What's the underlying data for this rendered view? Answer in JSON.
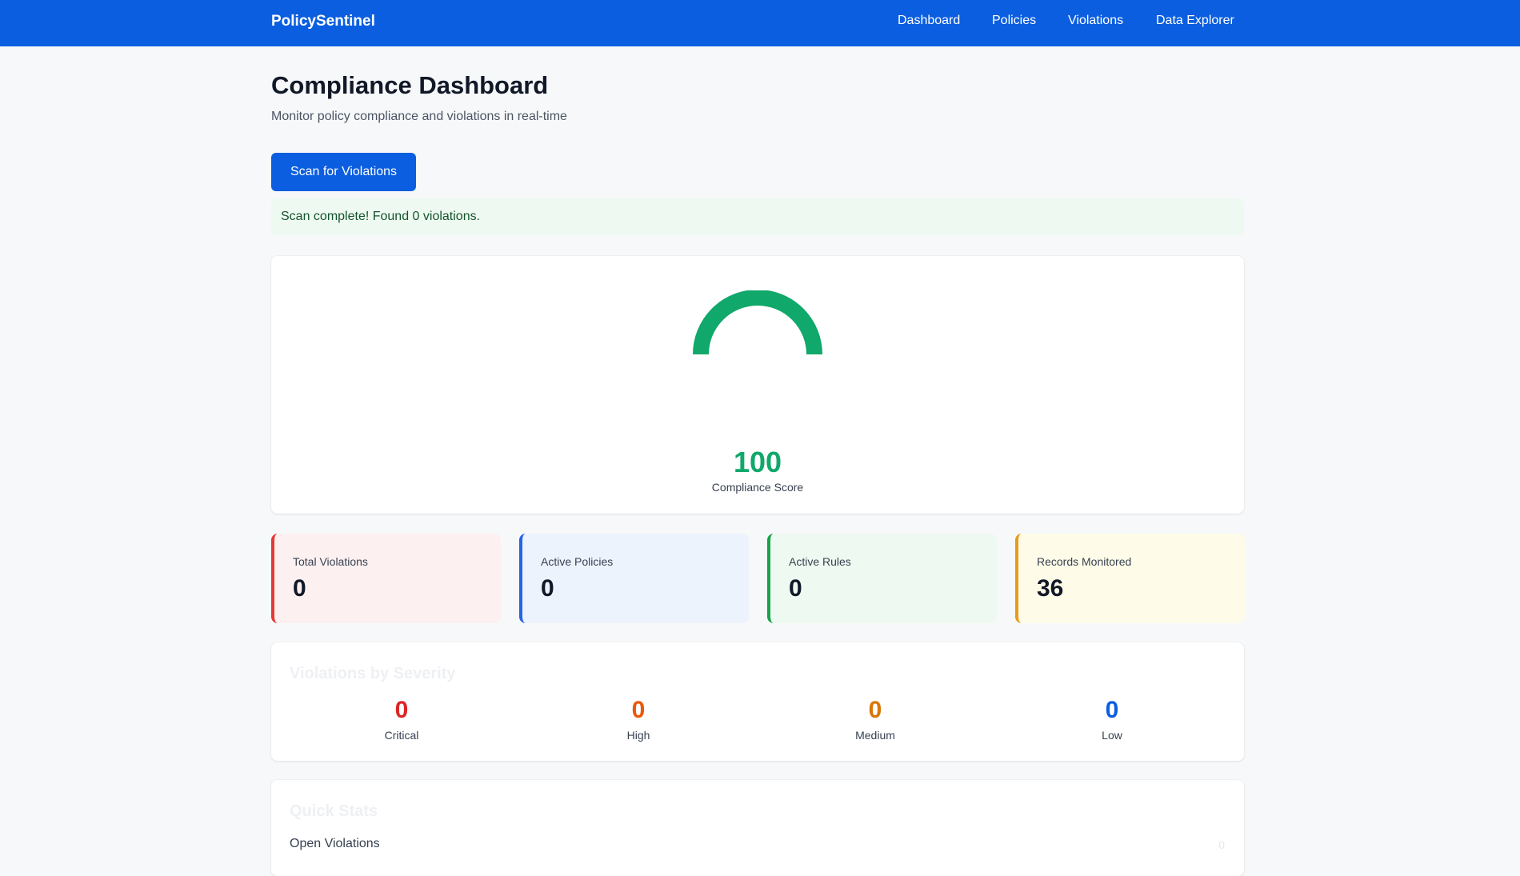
{
  "nav": {
    "brand": "PolicySentinel",
    "links": [
      "Dashboard",
      "Policies",
      "Violations",
      "Data Explorer"
    ]
  },
  "header": {
    "title": "Compliance Dashboard",
    "subtitle": "Monitor policy compliance and violations in real-time"
  },
  "scan": {
    "button_label": "Scan for Violations",
    "result_message": "Scan complete! Found 0 violations."
  },
  "compliance": {
    "score": "100",
    "label": "Compliance Score",
    "gauge_fraction": 0.5,
    "color": "#10a86b"
  },
  "stats": [
    {
      "label": "Total Violations",
      "value": "0",
      "accent": "#e53935",
      "bg": "#fdf0f0"
    },
    {
      "label": "Active Policies",
      "value": "0",
      "accent": "#2563eb",
      "bg": "#edf3fd"
    },
    {
      "label": "Active Rules",
      "value": "0",
      "accent": "#16a34a",
      "bg": "#eefaf1"
    },
    {
      "label": "Records Monitored",
      "value": "36",
      "accent": "#e89b1c",
      "bg": "#fefce8"
    }
  ],
  "severity": {
    "title": "Violations by Severity",
    "items": [
      {
        "label": "Critical",
        "value": "0",
        "color": "#dc2626"
      },
      {
        "label": "High",
        "value": "0",
        "color": "#ea580c"
      },
      {
        "label": "Medium",
        "value": "0",
        "color": "#d97706"
      },
      {
        "label": "Low",
        "value": "0",
        "color": "#0b5ee0"
      }
    ]
  },
  "quick_stats": {
    "title": "Quick Stats",
    "rows": [
      {
        "label": "Open Violations",
        "value": "0"
      }
    ]
  }
}
